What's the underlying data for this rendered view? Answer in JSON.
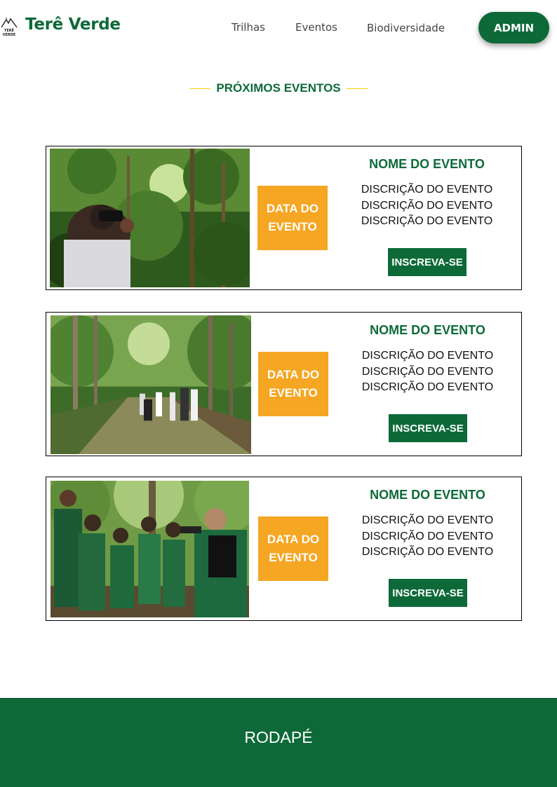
{
  "header": {
    "brand": "Terê Verde",
    "nav": [
      "Trilhas",
      "Eventos",
      "Biodiversidade"
    ],
    "admin_label": "ADMIN"
  },
  "section": {
    "title": "PRÓXIMOS EVENTOS"
  },
  "events": [
    {
      "date": "DATA DO EVENTO",
      "name": "NOME DO EVENTO",
      "description": [
        "DISCRIÇÃO DO EVENTO",
        "DISCRIÇÃO DO EVENTO",
        "DISCRIÇÃO DO EVENTO"
      ],
      "button": "INSCREVA-SE",
      "photo": "person-with-binoculars-in-forest"
    },
    {
      "date": "DATA DO EVENTO",
      "name": "NOME DO EVENTO",
      "description": [
        "DISCRIÇÃO DO EVENTO",
        "DISCRIÇÃO DO EVENTO",
        "DISCRIÇÃO DO EVENTO"
      ],
      "button": "INSCREVA-SE",
      "photo": "group-hiking-on-forest-trail"
    },
    {
      "date": "DATA DO EVENTO",
      "name": "NOME DO EVENTO",
      "description": [
        "DISCRIÇÃO DO EVENTO",
        "DISCRIÇÃO DO EVENTO",
        "DISCRIÇÃO DO EVENTO"
      ],
      "button": "INSCREVA-SE",
      "photo": "students-photography-workshop"
    }
  ],
  "footer": {
    "label": "RODAPÉ"
  },
  "colors": {
    "brand_green": "#0d6a38",
    "accent_orange": "#f5a623",
    "accent_yellow": "#f2d200"
  }
}
